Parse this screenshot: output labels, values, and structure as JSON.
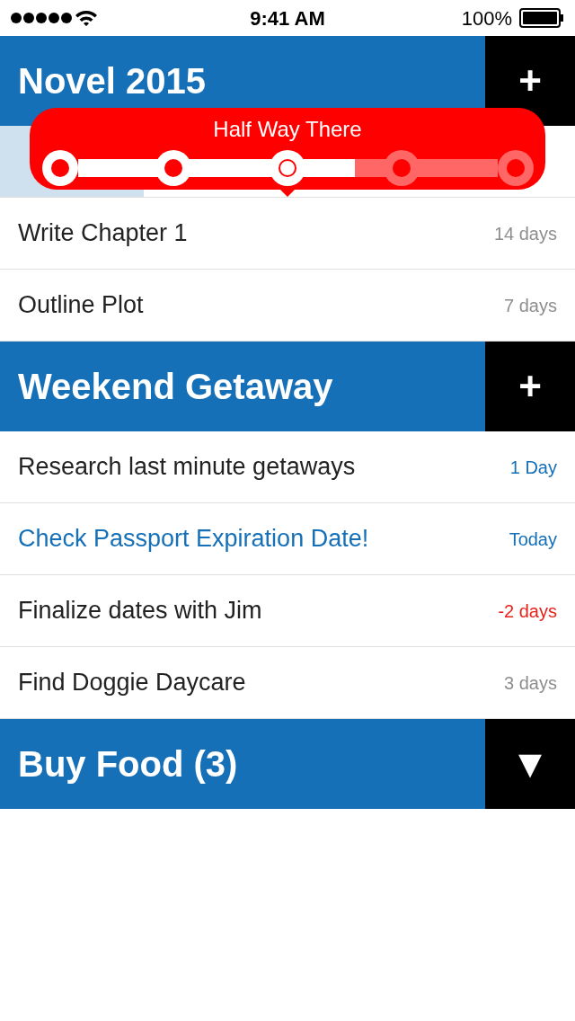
{
  "status_bar": {
    "time": "9:41 AM",
    "battery": "100%"
  },
  "popup": {
    "title": "Half Way There",
    "level": 0.66,
    "steps": [
      {
        "selected": false
      },
      {
        "selected": false
      },
      {
        "selected": true
      },
      {
        "selected": false
      },
      {
        "selected": false
      }
    ]
  },
  "sections": [
    {
      "title": "Novel 2015",
      "action": "+",
      "tasks": [
        {
          "level": 0.25
        },
        {
          "title": "Write Chapter 1",
          "due": "14 days",
          "color": "#8e8e8e",
          "highlighted": false
        },
        {
          "title": "Outline Plot",
          "due": "7 days",
          "color": "#8e8e8e",
          "highlighted": false
        }
      ]
    },
    {
      "title": "Weekend Getaway",
      "action": "+",
      "tasks": [
        {
          "title": "Research last minute getaways",
          "due": "1 Day",
          "color": "#1570b8",
          "highlighted": false
        },
        {
          "title": "Check Passport Expiration Date!",
          "due": "Today",
          "color": "#1570b8",
          "highlighted": true
        },
        {
          "title": "Finalize dates with Jim",
          "due": "-2 days",
          "color": "#e8221c",
          "highlighted": false
        },
        {
          "title": "Find Doggie Daycare",
          "due": "3 days",
          "color": "#8e8e8e",
          "highlighted": false
        }
      ]
    },
    {
      "title": "Buy Food (3)",
      "action": "▼"
    }
  ]
}
